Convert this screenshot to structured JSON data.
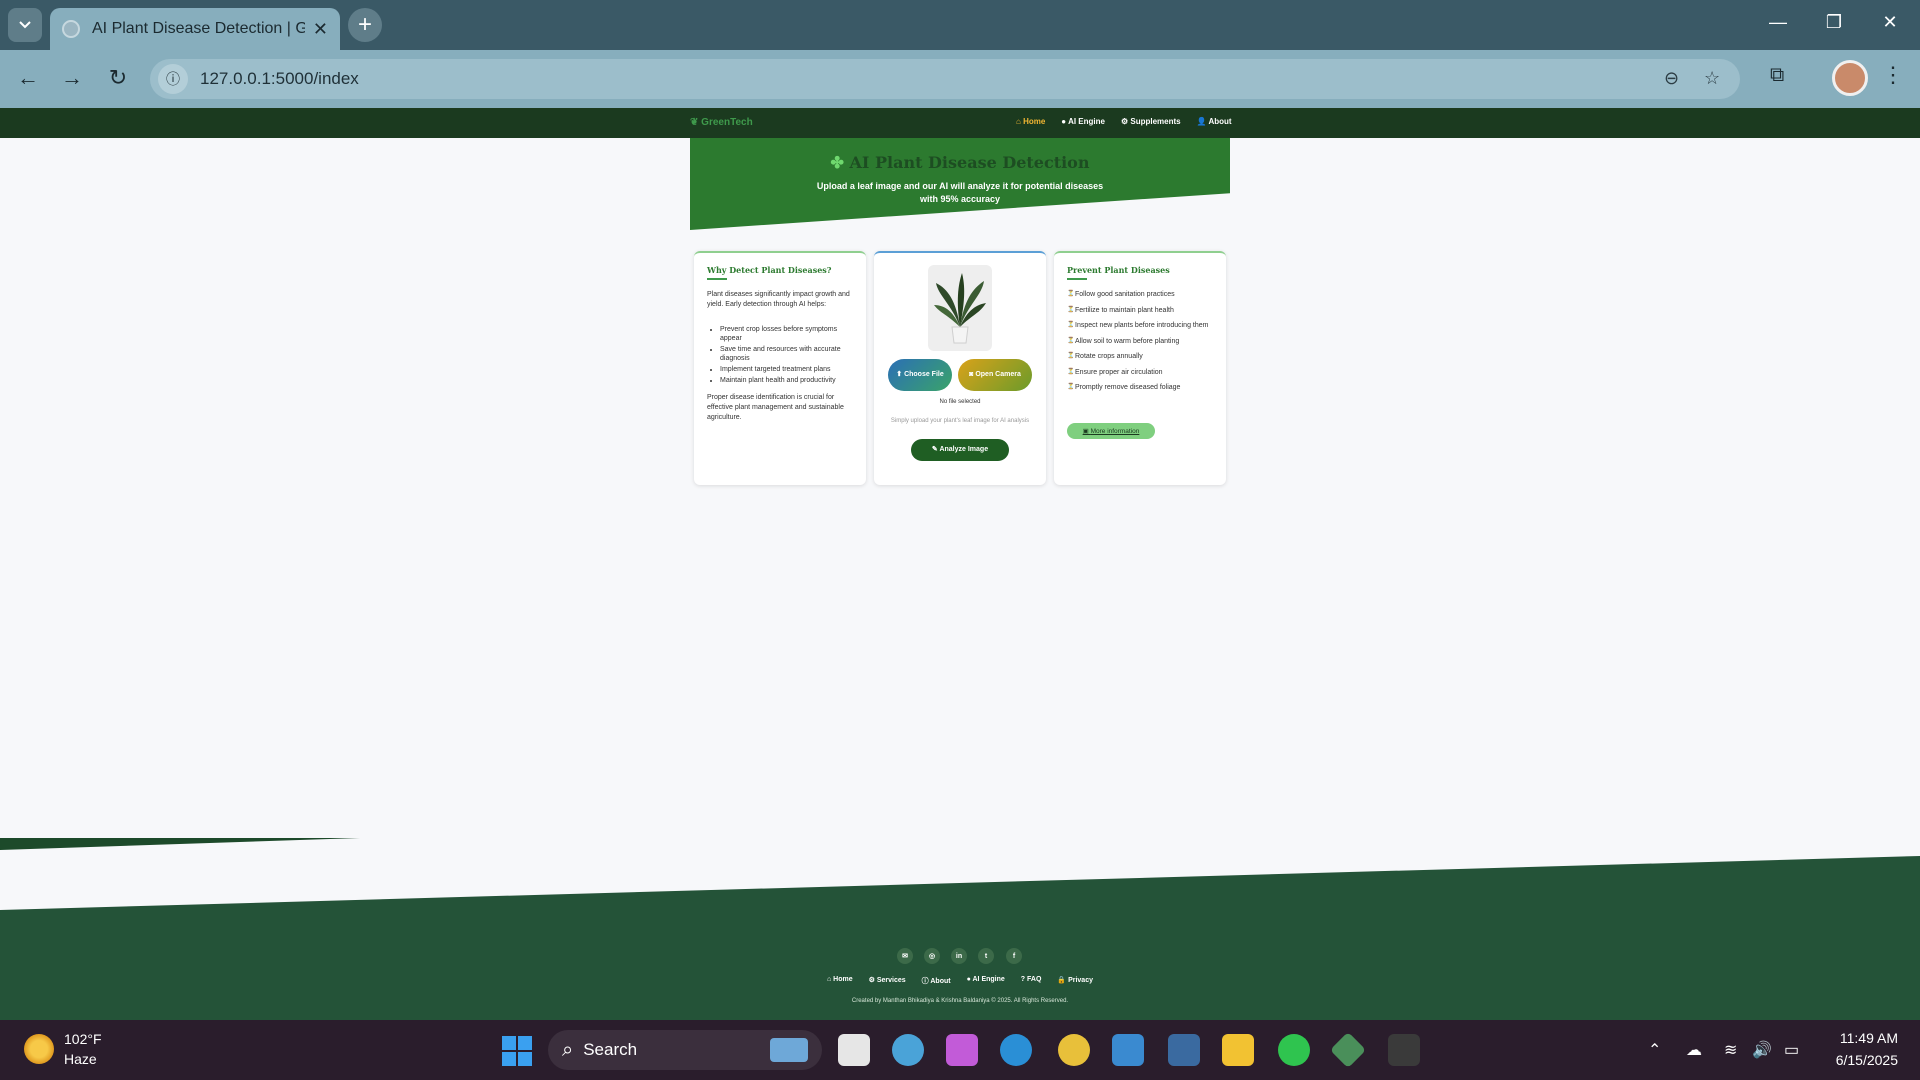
{
  "browser": {
    "tab_title": "AI Plant Disease Detection | Gre",
    "url": "127.0.0.1:5000/index",
    "new_tab": "+",
    "close_tab": "✕"
  },
  "site": {
    "brand": "GreenTech",
    "nav": [
      "Home",
      "AI Engine",
      "Supplements",
      "About"
    ],
    "hero": {
      "title": "AI Plant Disease Detection",
      "subtitle": "Upload a leaf image and our AI will analyze it for potential diseases with 95% accuracy"
    },
    "why_card": {
      "title": "Why Detect Plant Diseases?",
      "intro": "Plant diseases significantly impact growth and yield. Early detection through AI helps:",
      "bullets": [
        "Prevent crop losses before symptoms appear",
        "Save time and resources with accurate diagnosis",
        "Implement targeted treatment plans",
        "Maintain plant health and productivity"
      ],
      "outro": "Proper disease identification is crucial for effective plant management and sustainable agriculture."
    },
    "upload_card": {
      "choose_file": "Choose File",
      "open_camera": "Open Camera",
      "no_file": "No file selected",
      "hint": "Simply upload your plant's leaf image for AI analysis",
      "analyze": "Analyze Image"
    },
    "prevent_card": {
      "title": "Prevent Plant Diseases",
      "items": [
        "Follow good sanitation practices",
        "Fertilize to maintain plant health",
        "Inspect new plants before introducing them",
        "Allow soil to warm before planting",
        "Rotate crops annually",
        "Ensure proper air circulation",
        "Promptly remove diseased foliage"
      ],
      "more_info": "More information"
    },
    "footer": {
      "social": [
        "✉",
        "◎",
        "in",
        "t",
        "f"
      ],
      "links": [
        "Home",
        "Services",
        "About",
        "AI Engine",
        "FAQ",
        "Privacy"
      ],
      "copyright": "Created by Manthan Bhikadiya & Krishna Baldaniya © 2025. All Rights Reserved."
    }
  },
  "taskbar": {
    "temperature": "102°F",
    "condition": "Haze",
    "search": "Search",
    "time": "11:49 AM",
    "date": "6/15/2025"
  },
  "colors": {
    "nav_bg": "#1b3a1f",
    "hero_bg": "#2c7a2f",
    "accent": "#f2b632",
    "footer_bg": "#245338"
  }
}
